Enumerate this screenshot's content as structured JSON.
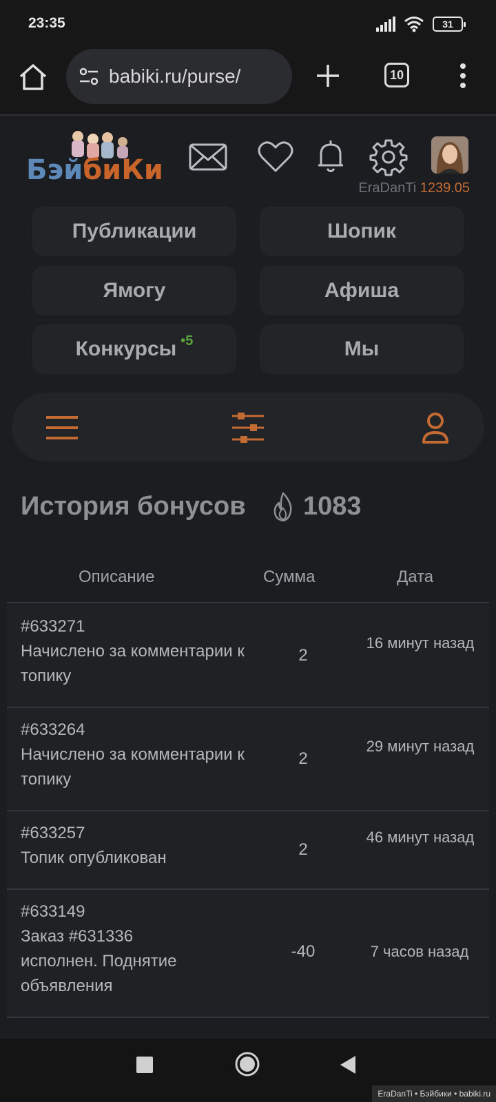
{
  "status": {
    "time": "23:35",
    "battery": "31"
  },
  "browser": {
    "url": "babiki.ru/purse/",
    "tab_count": "10"
  },
  "site": {
    "logo_part1": "Бэй",
    "logo_part2": "биКи",
    "username": "EraDanTi",
    "balance": "1239.05"
  },
  "nav": {
    "items": [
      {
        "label": "Публикации",
        "badge": ""
      },
      {
        "label": "Шопик",
        "badge": ""
      },
      {
        "label": "Ямогу",
        "badge": ""
      },
      {
        "label": "Афиша",
        "badge": ""
      },
      {
        "label": "Конкурсы",
        "badge": "•5"
      },
      {
        "label": "Мы",
        "badge": ""
      }
    ]
  },
  "history": {
    "title": "История бонусов",
    "count": "1083",
    "columns": [
      "Описание",
      "Сумма",
      "Дата"
    ],
    "rows": [
      {
        "id": "#633271",
        "text": "Начислено за комментарии к топику",
        "sum": "2",
        "date": "16 минут назад"
      },
      {
        "id": "#633264",
        "text": "Начислено за комментарии к топику",
        "sum": "2",
        "date": "29 минут назад"
      },
      {
        "id": "#633257",
        "text": "Топик опубликован",
        "sum": "2",
        "date": "46 минут назад"
      },
      {
        "id": "#633149",
        "text": "Заказ #631336 исполнен. Поднятие объявления",
        "sum": "-40",
        "date": "7 часов назад"
      }
    ]
  },
  "watermark": "EraDanTi • Бэйбики • babiki.ru",
  "colors": {
    "accent": "#c46a33",
    "badge_green": "#5aa33c",
    "logo_blue": "#5d89b8"
  },
  "icons": [
    "home-icon",
    "site-settings-icon",
    "plus-icon",
    "tabs-icon",
    "more-icon",
    "mail-icon",
    "heart-icon",
    "bell-icon",
    "gear-icon",
    "hamburger-icon",
    "filter-icon",
    "user-icon",
    "flame-icon",
    "square-icon",
    "circle-icon",
    "back-icon"
  ]
}
